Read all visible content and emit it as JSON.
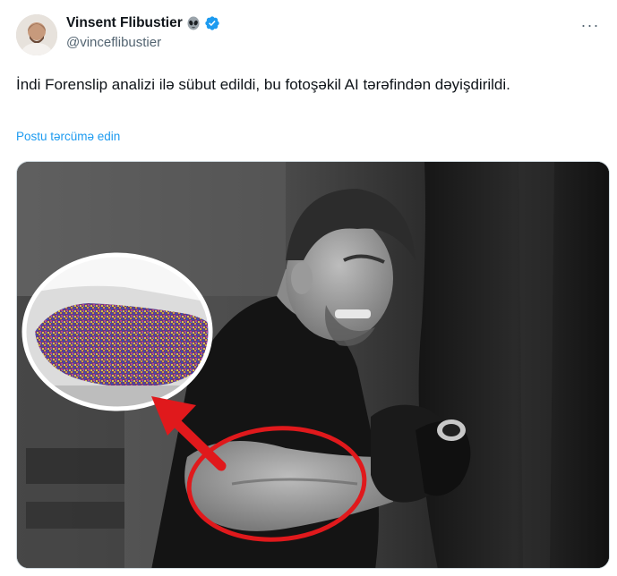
{
  "author": {
    "display_name": "Vinsent Flibustier",
    "handle": "@vinceflibustier",
    "name_emoji_icon": "alien-icon",
    "verified_icon": "verified-badge-icon"
  },
  "menu": {
    "more_label": "···",
    "icon": "more-options-icon"
  },
  "tweet": {
    "text": "İndi Forenslip analizi ilə sübut edildi, bu fotoşəkil AI tərəfindən dəyişdirildi.",
    "translate_link": "Postu tərcümə edin"
  },
  "colors": {
    "link": "#1d9bf0",
    "verified": "#1d9bf0",
    "annotation_red": "#e0191c",
    "secondary_text": "#536471"
  }
}
